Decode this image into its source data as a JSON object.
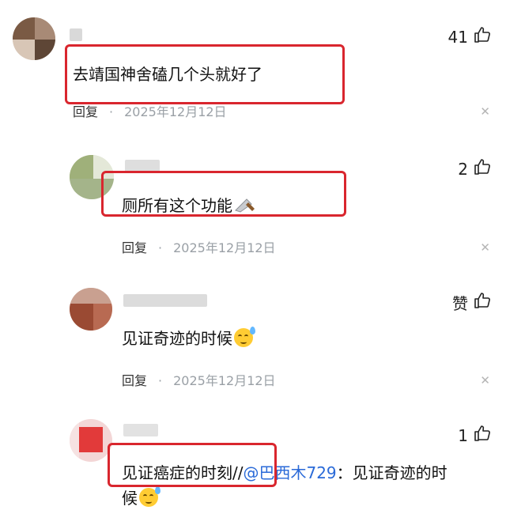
{
  "comments": [
    {
      "likes": "41",
      "text": "去靖国神舍磕几个头就好了",
      "reply_label": "回复",
      "separator": "·",
      "date": "2025年12月12日"
    },
    {
      "likes": "2",
      "text": "厕所有这个功能",
      "reply_label": "回复",
      "separator": "·",
      "date": "2025年12月12日"
    },
    {
      "likes": "赞",
      "text": "见证奇迹的时候",
      "reply_label": "回复",
      "separator": "·",
      "date": "2025年12月12日"
    },
    {
      "likes": "1",
      "text_main": "见证癌症的时刻//",
      "mention": "@巴西木729",
      "text_after": "：见证奇迹的时",
      "text_line2": "候"
    }
  ],
  "icons": {
    "like": "thumbs-up-icon",
    "close": "close-icon",
    "knife": "kitchen-knife-emoji",
    "face": "sweat-smile-emoji"
  },
  "colors": {
    "highlight_box": "#d9262e",
    "mention": "#2a6ad8",
    "meta": "#9aa0a6"
  }
}
